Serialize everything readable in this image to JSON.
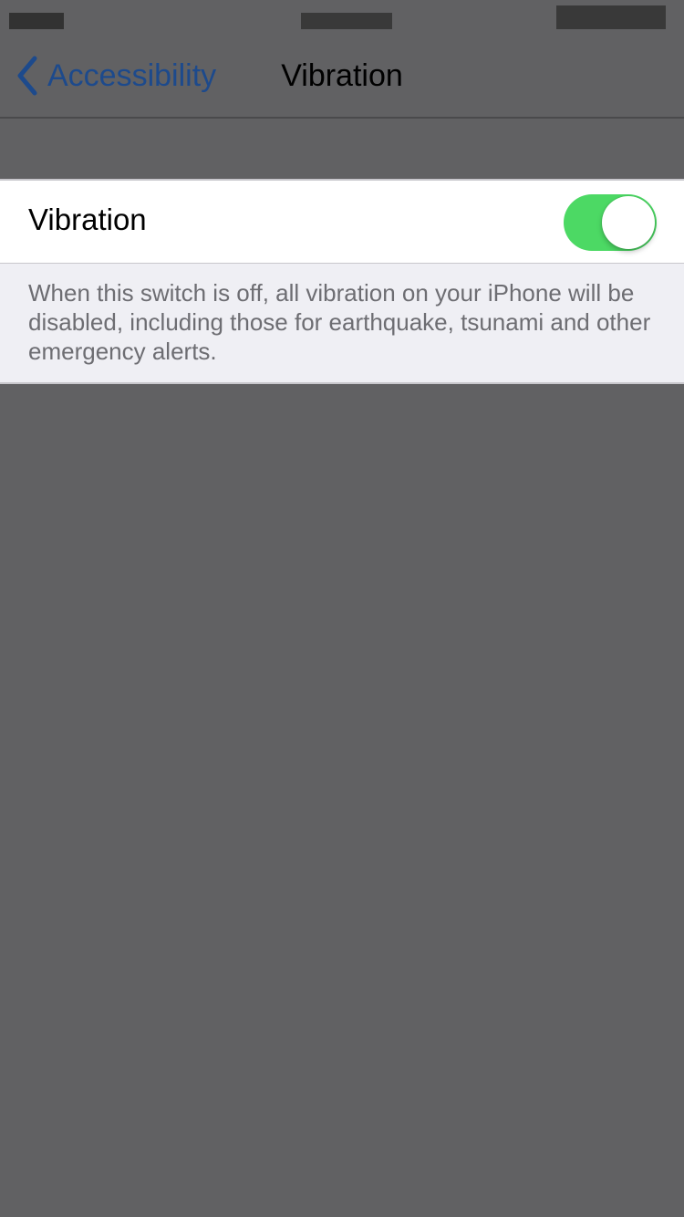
{
  "status_bar": {
    "obscured": true
  },
  "nav": {
    "back_label": "Accessibility",
    "title": "Vibration"
  },
  "settings": {
    "vibration": {
      "label": "Vibration",
      "enabled": true,
      "accent_color": "#4cd964"
    },
    "footer_text": "When this switch is off, all vibration on your iPhone will be disabled, including those for earthquake, tsunami and other emergency alerts."
  },
  "colors": {
    "link": "#1d4a8c",
    "overlay_background": "#616163"
  }
}
